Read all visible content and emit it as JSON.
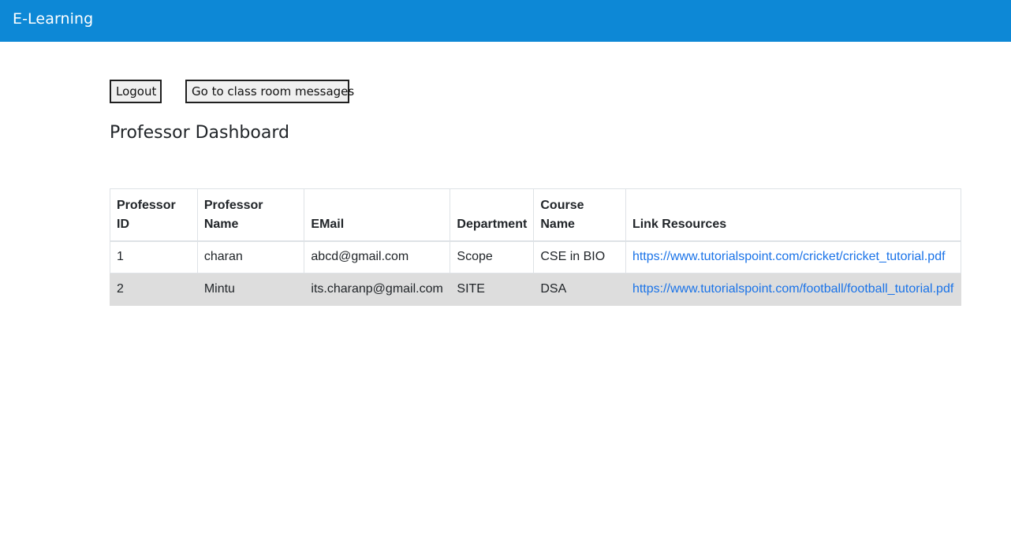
{
  "app": {
    "brand": "E-Learning"
  },
  "actions": {
    "logout_label": "Logout",
    "messages_label": "Go to class room messages"
  },
  "page": {
    "title": "Professor Dashboard"
  },
  "table": {
    "headers": [
      "Professor ID",
      "Professor Name",
      "EMail",
      "Department",
      "Course Name",
      "Link Resources"
    ],
    "rows": [
      [
        "1",
        "charan",
        "abcd@gmail.com",
        "Scope",
        "CSE in BIO",
        "https://www.tutorialspoint.com/cricket/cricket_tutorial.pdf"
      ],
      [
        "2",
        "Mintu",
        "its.charanp@gmail.com",
        "SITE",
        "DSA",
        "https://www.tutorialspoint.com/football/football_tutorial.pdf"
      ]
    ]
  },
  "colors": {
    "navbar": "#0d88d6",
    "link": "#1a73e8",
    "alt_row": "#dddddd"
  }
}
